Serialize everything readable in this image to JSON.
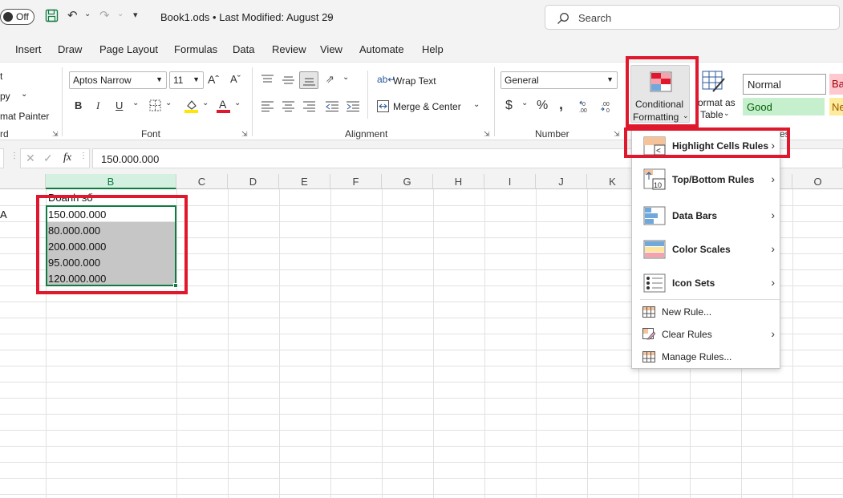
{
  "titlebar": {
    "autosave_state": "Off",
    "doc_title": "Book1.ods • Last Modified: August 29",
    "search_placeholder": "Search"
  },
  "menu_tabs": [
    "Insert",
    "Draw",
    "Page Layout",
    "Formulas",
    "Data",
    "Review",
    "View",
    "Automate",
    "Help"
  ],
  "ribbon": {
    "clipboard": {
      "copy_label": "py",
      "format_painter_label": "mat Painter",
      "group_label": "rd"
    },
    "font": {
      "font_name": "Aptos Narrow",
      "font_size": "11",
      "bold": "B",
      "italic": "I",
      "underline": "U",
      "group_label": "Font"
    },
    "alignment": {
      "wrap_text": "Wrap Text",
      "merge_center": "Merge & Center",
      "group_label": "Alignment"
    },
    "number": {
      "format": "General",
      "currency": "$",
      "percent": "%",
      "comma": ",",
      "group_label": "Number"
    },
    "styles": {
      "conditional_formatting_line1": "Conditional",
      "conditional_formatting_line2": "Formatting",
      "format_as_table_line1": "ormat as",
      "format_as_table_line2": "Table",
      "style_normal": "Normal",
      "style_good": "Good",
      "style_bad": "Ba",
      "style_neutral": "Ne",
      "group_label_partial": "es"
    }
  },
  "formula_bar": {
    "fx": "fx",
    "value": "150.000.000"
  },
  "sheet": {
    "columns": [
      "B",
      "C",
      "D",
      "E",
      "F",
      "G",
      "H",
      "I",
      "J",
      "K",
      "L",
      "M",
      "N",
      "O"
    ],
    "header_cell": "Doanh số",
    "left_cell": "A",
    "values": [
      "150.000.000",
      "80.000.000",
      "200.000.000",
      "95.000.000",
      "120.000.000"
    ]
  },
  "dropdown": {
    "items": [
      {
        "label": "Highlight Cells Rules",
        "icon": "highlight-cells-icon",
        "submenu": true
      },
      {
        "label": "Top/Bottom Rules",
        "icon": "top-bottom-icon",
        "submenu": true
      },
      {
        "label": "Data Bars",
        "icon": "data-bars-icon",
        "submenu": true
      },
      {
        "label": "Color Scales",
        "icon": "color-scales-icon",
        "submenu": true
      },
      {
        "label": "Icon Sets",
        "icon": "icon-sets-icon",
        "submenu": true
      }
    ],
    "actions": [
      {
        "label": "New Rule...",
        "icon": "new-rule-icon",
        "submenu": false
      },
      {
        "label": "Clear Rules",
        "icon": "clear-rules-icon",
        "submenu": true
      },
      {
        "label": "Manage Rules...",
        "icon": "manage-rules-icon",
        "submenu": false
      }
    ]
  },
  "colors": {
    "accent_green": "#107c41",
    "highlight_red": "#e0182d",
    "good_fill": "#c6efce",
    "bad_fill": "#ffc7ce",
    "neutral_fill": "#ffeb9c"
  }
}
